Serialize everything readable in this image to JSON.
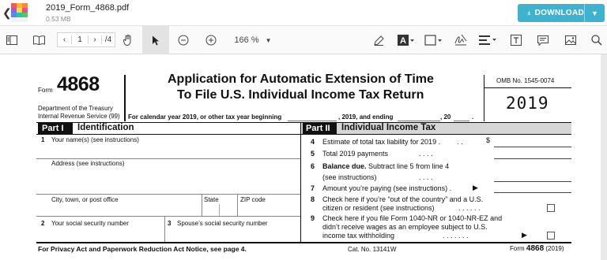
{
  "app": {
    "filename": "2019_Form_4868.pdf",
    "filesize": "0.53 MB",
    "download_label": "DOWNLOAD",
    "page_current": "1",
    "page_total": "/4",
    "zoom": "166 %"
  },
  "form": {
    "form_word": "Form",
    "form_number": "4868",
    "dept_line1": "Department of the Treasury",
    "dept_line2": "Internal Revenue Service (99)",
    "title_line1": "Application for Automatic Extension of Time",
    "title_line2": "To File U.S. Individual Income Tax Return",
    "calendar_line": "For calendar year 2019, or other tax year beginning",
    "calendar_and": ", 2019, and ending",
    "calendar_20": ", 20",
    "calendar_dot": ".",
    "omb": "OMB No. 1545-0074",
    "year": "2019",
    "part1_label": "Part I",
    "part1_title": "Identification",
    "part2_label": "Part II",
    "part2_title": "Individual Income Tax",
    "l1_num": "1",
    "l1_text": "Your name(s) (see instructions)",
    "address": "Address (see instructions)",
    "city": "City, town, or post office",
    "state": "State",
    "zip": "ZIP code",
    "l2_num": "2",
    "l2_text": "Your social security number",
    "l3_num": "3",
    "l3_text": "Spouse’s social security number",
    "l4_num": "4",
    "l4_text": "Estimate of total tax liability for 2019 .",
    "l4_dots": ". .",
    "dollar": "$",
    "l5_num": "5",
    "l5_text": "Total 2019 payments",
    "l5_dots": ". . . .",
    "l6_num": "6",
    "l6_bold": "Balance due.",
    "l6_text": " Subtract line 5 from line 4",
    "l6_text2": "(see instructions)",
    "l6_dots": ". . . .",
    "l7_num": "7",
    "l7_text": "Amount you’re paying (see instructions) .",
    "l8_num": "8",
    "l8_text1": "Check here if you’re “out of the country” and a U.S.",
    "l8_text2": "citizen or resident (see instructions)",
    "l8_dots": ". . . . . .",
    "l9_num": "9",
    "l9_text1": "Check here if you file Form 1040-NR or 1040-NR-EZ and",
    "l9_text2": "didn’t receive wages as an employee subject to U.S.",
    "l9_text3": "income tax withholding",
    "l9_dots": ". . . . . . .",
    "footer_left": "For Privacy Act and Paperwork Reduction Act Notice, see page 4.",
    "footer_cat": "Cat. No. 13141W",
    "footer_form": "Form",
    "footer_num": "4868",
    "footer_year": "(2019)"
  },
  "colors": {
    "accent": "#3fb2cf",
    "part_bar": "#111111",
    "part2_bg": "#d6d6d6"
  },
  "icons": [
    "back-arrow-icon",
    "app-logo-icon",
    "download-icon",
    "chevron-down-icon",
    "sidebar-icon",
    "book-icon",
    "chevron-left-icon",
    "chevron-right-icon",
    "hand-icon",
    "cursor-icon",
    "zoom-out-icon",
    "zoom-in-icon",
    "pen-icon",
    "text-icon",
    "rectangle-icon",
    "signature-icon",
    "align-icon",
    "textbox-icon",
    "comment-icon",
    "image-icon",
    "search-icon"
  ]
}
